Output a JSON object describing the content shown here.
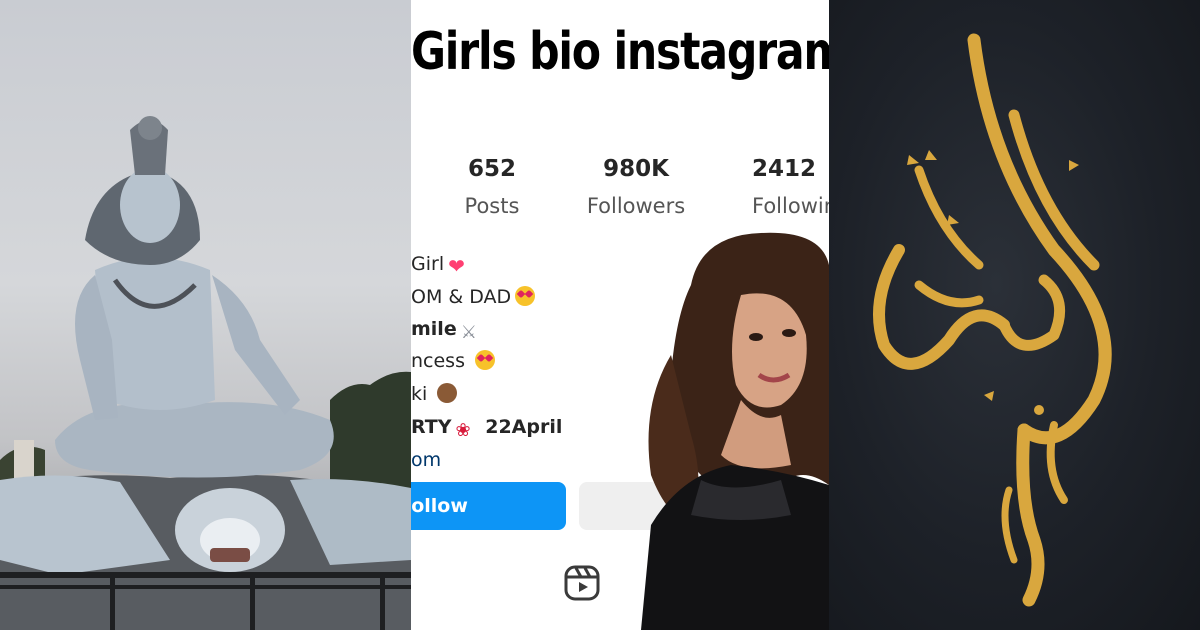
{
  "headline": "Girls bio instagram",
  "stats": [
    {
      "value": "652",
      "label": "Posts"
    },
    {
      "value": "980K",
      "label": "Followers"
    },
    {
      "value": "2412",
      "label": "Following"
    }
  ],
  "bio": {
    "line1": "Girl",
    "line2": "OM & DAD",
    "line3": "mile",
    "line4": "ncess",
    "line5": "ki",
    "line6": "RTY",
    "line6_date": "22April",
    "line7": "om"
  },
  "buttons": {
    "follow": "Follow"
  },
  "icons": {
    "reels": "reels-icon",
    "heart": "heart-emoji-icon",
    "heart_eyes": "heart-eyes-emoji-icon",
    "swords": "crossed-swords-emoji-icon",
    "kiss": "kissing-face-emoji-icon",
    "monkey": "see-no-evil-monkey-emoji-icon",
    "ribbon": "ribbon-emoji-icon"
  },
  "colors": {
    "follow_button": "#0d95f6",
    "calligraphy_gold": "#d9a73e",
    "right_background": "#1d2128"
  }
}
